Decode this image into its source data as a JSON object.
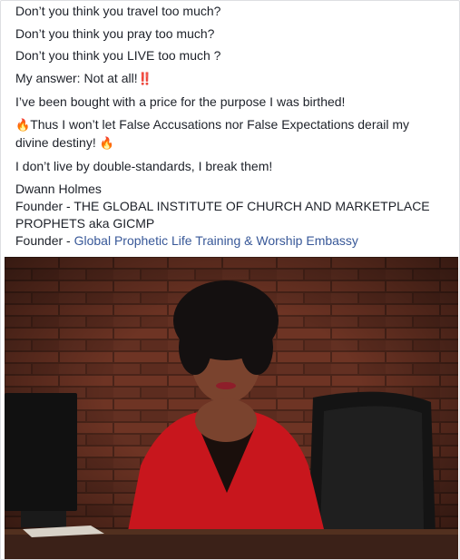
{
  "post": {
    "lines": [
      "Don’t you think you travel too much?",
      "Don’t you think you pray too much?",
      "Don’t you think you LIVE too much ?",
      "My answer: Not at all!",
      "I’ve been bought with a price for the purpose I was birthed!",
      "Thus I won’t let False Accusations nor False Expectations derail my",
      "divine destiny!",
      "I don’t live by double-standards, I break them!",
      "Dwann Holmes",
      "Founder - THE GLOBAL INSTITUTE OF CHURCH AND MARKETPLACE",
      "PROPHETS aka GICMP",
      "Founder - "
    ],
    "link_text": "Global Prophetic Life Training & Worship Embassy",
    "emoji_double_exclamation": "‼️",
    "emoji_fire": "🔥"
  },
  "colors": {
    "link": "#385898",
    "text": "#1d2129",
    "border": "#dddfe2"
  },
  "photo": {
    "icon": "photo-of-woman-in-red-blazer-at-desk"
  }
}
